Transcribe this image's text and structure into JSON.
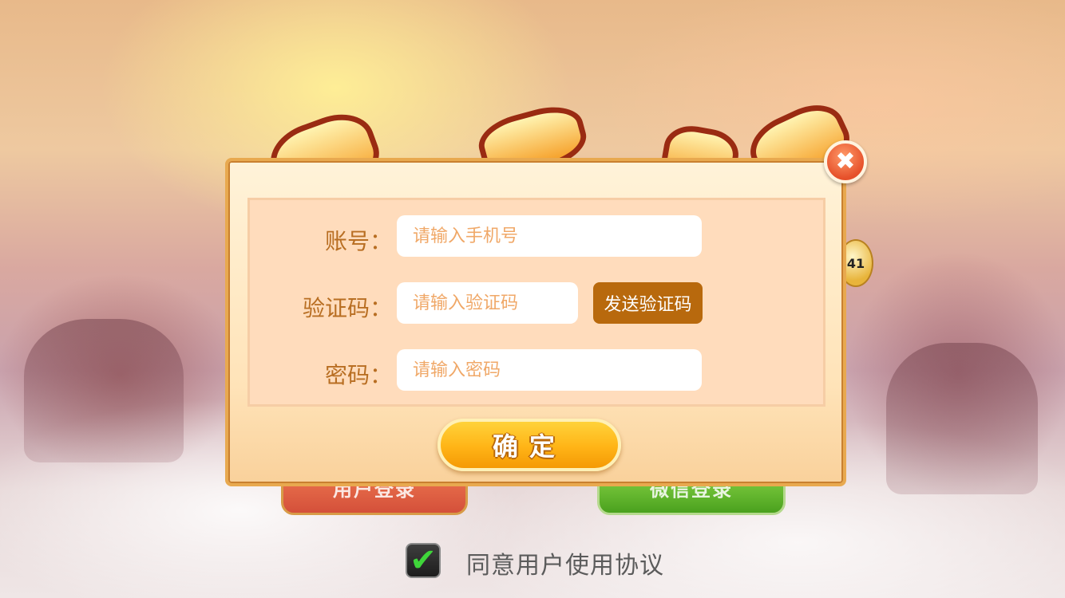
{
  "background": {
    "title_art_text": "",
    "lottery_ball_number": "41",
    "buttons": {
      "user_login_label": "用户登录",
      "wechat_login_label": "微信登录"
    }
  },
  "agreement": {
    "checked": true,
    "check_glyph": "✔",
    "label": "同意用户使用协议"
  },
  "login_dialog": {
    "fields": {
      "account": {
        "label": "账号：",
        "placeholder": "请输入手机号",
        "value": ""
      },
      "verification_code": {
        "label": "验证码：",
        "placeholder": "请输入验证码",
        "value": ""
      },
      "password": {
        "label": "密码：",
        "placeholder": "请输入密码",
        "value": ""
      }
    },
    "send_code_label": "发送验证码",
    "confirm_label": "确定",
    "close_glyph": "✖"
  },
  "colors": {
    "label_color": "#b86e22",
    "placeholder_color": "#f0a868",
    "send_code_bg": "#b8690d",
    "confirm_bg": "#ffb416",
    "close_bg": "#e6502a"
  }
}
